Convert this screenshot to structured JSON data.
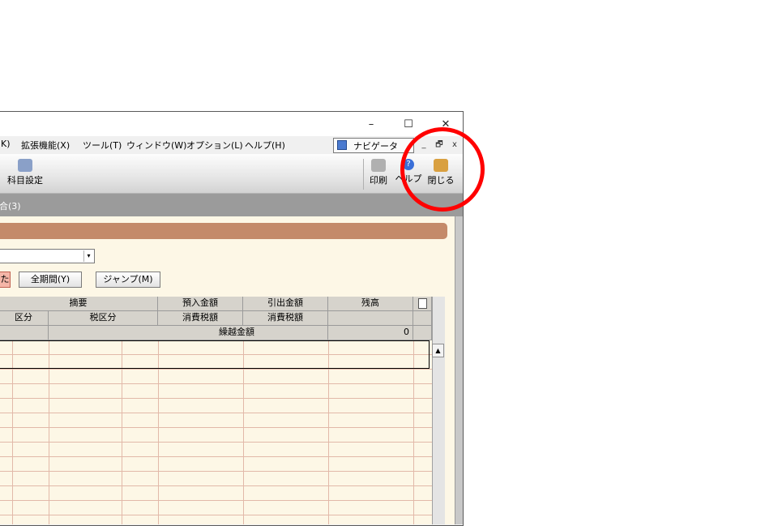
{
  "window": {
    "caption_buttons": {
      "minimize": "–",
      "maximize": "☐",
      "close": "✕"
    }
  },
  "menubar": {
    "items": [
      "K)",
      "拡張機能(X)",
      "ツール(T)",
      "ウィンドウ(W)",
      "オプション(L)",
      "ヘルプ(H)"
    ],
    "navigator_label": "ナビゲータ",
    "mdi_buttons": {
      "minimize": "_",
      "restore": "🗗",
      "close": "x"
    }
  },
  "toolbar": {
    "account_settings": "科目設定",
    "print": "印刷",
    "help": "ヘルプ",
    "close": "閉じる"
  },
  "tab": {
    "label": "合(3)"
  },
  "controls": {
    "pink_button": "た",
    "all_period_button": "全期間(Y)",
    "jump_button": "ジャンプ(M)"
  },
  "grid": {
    "header_row1": {
      "summary": "摘要",
      "deposit": "預入金額",
      "withdrawal": "引出金額",
      "balance": "残高"
    },
    "header_row2": {
      "category": "区分",
      "tax_category": "税区分",
      "consumption_tax_1": "消費税額",
      "consumption_tax_2": "消費税額"
    },
    "header_row3": {
      "carryover_label": "繰越金額",
      "carryover_value": "0"
    }
  },
  "colors": {
    "annotation_circle": "#ff0000",
    "banner": "#c48a6a",
    "grid_bg": "#fdf7e6"
  }
}
